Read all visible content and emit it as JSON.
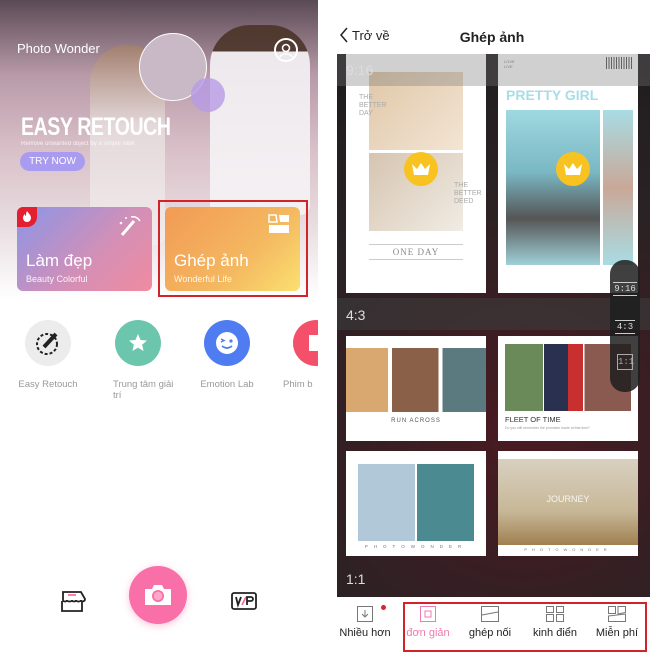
{
  "home": {
    "app_title": "Photo Wonder",
    "banner": {
      "title": "EASY RETOUCH",
      "subtitle": "Remove unwanted object by a simple slide",
      "cta": "TRY NOW"
    },
    "cards": [
      {
        "title": "Làm đẹp",
        "subtitle": "Beauty Colorful",
        "icon": "magic-wand-icon",
        "badge": "flame-icon"
      },
      {
        "title": "Ghép ảnh",
        "subtitle": "Wonderful Life",
        "icon": "collage-icon",
        "highlighted": true
      }
    ],
    "features": [
      {
        "label": "Easy Retouch",
        "icon": "retouch-brush-icon",
        "color": "#ececec"
      },
      {
        "label": "Trung tâm giải trí",
        "icon": "star-icon",
        "color": "#6cc6ad"
      },
      {
        "label": "Emotion Lab",
        "icon": "wink-face-icon",
        "color": "#4f7cf0"
      },
      {
        "label": "Phim b",
        "icon": "film-icon",
        "color": "#f5506a"
      }
    ],
    "bottom": {
      "left_icon": "store-icon",
      "center_icon": "camera-icon",
      "right_icon": "vip-icon",
      "camera_color": "#f96fa8"
    }
  },
  "collage": {
    "back_label": "Trở về",
    "title": "Ghép ảnh",
    "sections": [
      {
        "ratio": "9:16",
        "templates": [
          {
            "texts": [
              "THE BETTER DAY",
              "THE BETTER DEED",
              "ONE DAY"
            ],
            "premium": true
          },
          {
            "texts": [
              "LOVE LIVE",
              "PRETTY GIRL"
            ],
            "premium": true
          }
        ]
      },
      {
        "ratio": "4:3",
        "templates": [
          {
            "texts": [
              "RUN ACROSS"
            ]
          },
          {
            "texts": [
              "FLEET OF TIME",
              "Do you still remember the promises made at that time?"
            ]
          },
          {
            "texts": [
              "PHOTOWONDER"
            ]
          },
          {
            "texts": [
              "JOURNEY",
              "PHOTOWONDER"
            ]
          }
        ]
      },
      {
        "ratio": "1:1",
        "templates": []
      }
    ],
    "ratio_switcher": [
      "9:16",
      "4:3",
      "1:1"
    ],
    "tabs": [
      {
        "label": "Nhiều hơn",
        "icon": "download-icon",
        "dot": true
      },
      {
        "label": "đơn giản",
        "icon": "single-frame-icon",
        "active": true
      },
      {
        "label": "ghép nối",
        "icon": "joined-frame-icon"
      },
      {
        "label": "kinh điển",
        "icon": "grid-frame-icon"
      },
      {
        "label": "Miễn phí",
        "icon": "free-frame-icon"
      }
    ],
    "accent": "#f07ab0"
  }
}
